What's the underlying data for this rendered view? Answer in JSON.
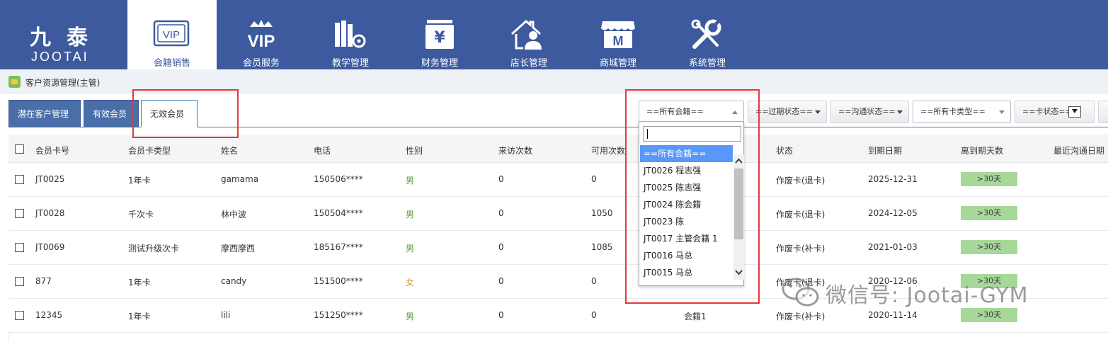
{
  "brand": {
    "cn": "九泰",
    "en": "JOOTAI"
  },
  "nav": [
    {
      "label": "会籍销售",
      "icon": "vip-card-icon",
      "active": true
    },
    {
      "label": "会员服务",
      "icon": "vip-crown-icon",
      "active": false
    },
    {
      "label": "教学管理",
      "icon": "books-gear-icon",
      "active": false
    },
    {
      "label": "财务管理",
      "icon": "yen-box-icon",
      "active": false
    },
    {
      "label": "店长管理",
      "icon": "manager-house-icon",
      "active": false
    },
    {
      "label": "商城管理",
      "icon": "store-icon",
      "active": false
    },
    {
      "label": "系统管理",
      "icon": "tools-icon",
      "active": false
    }
  ],
  "breadcrumb": {
    "label": "客户资源管理(主管)"
  },
  "tabs": [
    {
      "label": "潜在客户管理",
      "active": false
    },
    {
      "label": "有效会员",
      "active": false
    },
    {
      "label": "无效会员",
      "active": true
    }
  ],
  "filters": {
    "membership_consultant": "==所有会籍==",
    "expiry_status": "==过期状态==",
    "contact_status": "==沟通状态==",
    "card_type": "==所有卡类型==",
    "card_status": "==卡状态=="
  },
  "dropdown": {
    "search_value": "",
    "options": [
      {
        "label": "==所有会籍==",
        "highlighted": true
      },
      {
        "label": "JT0026 程志强",
        "highlighted": false
      },
      {
        "label": "JT0025 陈志强",
        "highlighted": false
      },
      {
        "label": "JT0024 陈会籍",
        "highlighted": false
      },
      {
        "label": "JT0023 陈",
        "highlighted": false
      },
      {
        "label": "JT0017 主管会籍 1",
        "highlighted": false
      },
      {
        "label": "JT0016 马总",
        "highlighted": false
      },
      {
        "label": "JT0015 马总",
        "highlighted": false
      }
    ]
  },
  "table": {
    "headers": {
      "card_no": "会员卡号",
      "card_type": "会员卡类型",
      "name": "姓名",
      "phone": "电话",
      "gender": "性别",
      "visits": "来访次数",
      "remaining": "可用次数",
      "status": "状态",
      "expiry_date": "到期日期",
      "days_left": "离到期天数",
      "last_contact": "最近沟通日期"
    },
    "rows": [
      {
        "card_no": "JT0025",
        "card_type": "1年卡",
        "name": "gamama",
        "phone": "150506****",
        "gender": "男",
        "gender_code": "m",
        "visits": "0",
        "remaining": "0",
        "consultant": "",
        "status": "作废卡(退卡)",
        "expiry_date": "2025-12-31",
        "days_left": ">30天"
      },
      {
        "card_no": "JT0028",
        "card_type": "千次卡",
        "name": "林中波",
        "phone": "150504****",
        "gender": "男",
        "gender_code": "m",
        "visits": "0",
        "remaining": "1050",
        "consultant": "",
        "status": "作废卡(退卡)",
        "expiry_date": "2024-12-05",
        "days_left": ">30天"
      },
      {
        "card_no": "JT0069",
        "card_type": "测试升级次卡",
        "name": "摩西摩西",
        "phone": "185167****",
        "gender": "男",
        "gender_code": "m",
        "visits": "0",
        "remaining": "1085",
        "consultant": "",
        "status": "作废卡(补卡)",
        "expiry_date": "2021-01-03",
        "days_left": ">30天"
      },
      {
        "card_no": "877",
        "card_type": "1年卡",
        "name": "candy",
        "phone": "151500****",
        "gender": "女",
        "gender_code": "f",
        "visits": "0",
        "remaining": "0",
        "consultant": "",
        "status": "作废卡(退卡)",
        "expiry_date": "2020-12-06",
        "days_left": ">30天"
      },
      {
        "card_no": "12345",
        "card_type": "1年卡",
        "name": "lili",
        "phone": "151250****",
        "gender": "男",
        "gender_code": "m",
        "visits": "0",
        "remaining": "0",
        "consultant": "会籍1",
        "status": "作废卡(补卡)",
        "expiry_date": "2020-11-14",
        "days_left": ">30天"
      }
    ]
  },
  "watermark": {
    "text": "微信号: Jootai-GYM"
  },
  "colors": {
    "nav_bg": "#3d5a9e",
    "highlight": "#5897fb",
    "annotation": "#e53935",
    "badge": "#a8d79a",
    "male": "#5aa035",
    "female": "#e0961c"
  }
}
